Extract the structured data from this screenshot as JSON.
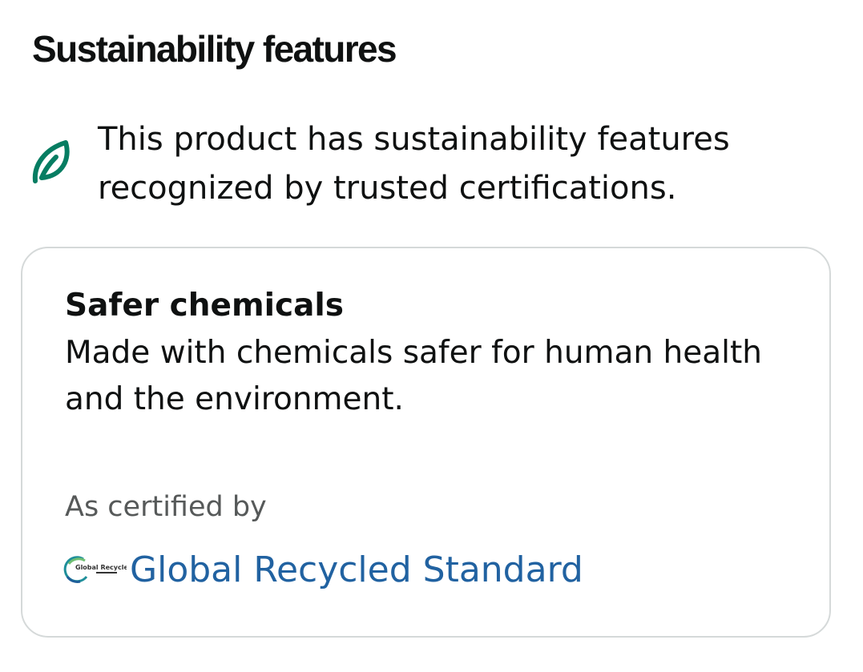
{
  "header": {
    "title": "Sustainability features"
  },
  "summary": {
    "icon": "leaf-icon",
    "text": "This product has sustainability features recognized by trusted certifications."
  },
  "card": {
    "title": "Safer chemicals",
    "description": "Made with chemicals safer for human health and the environment.",
    "certified_by_label": "As certified by",
    "certification": {
      "logo": "global-recycled-standard-logo",
      "logo_text": "Global Recycled Standard",
      "link_text": "Global Recycled Standard"
    }
  },
  "colors": {
    "leaf": "#067d62",
    "link": "#2162a1",
    "secondary_text": "#565959",
    "border": "#d5d9d9"
  }
}
